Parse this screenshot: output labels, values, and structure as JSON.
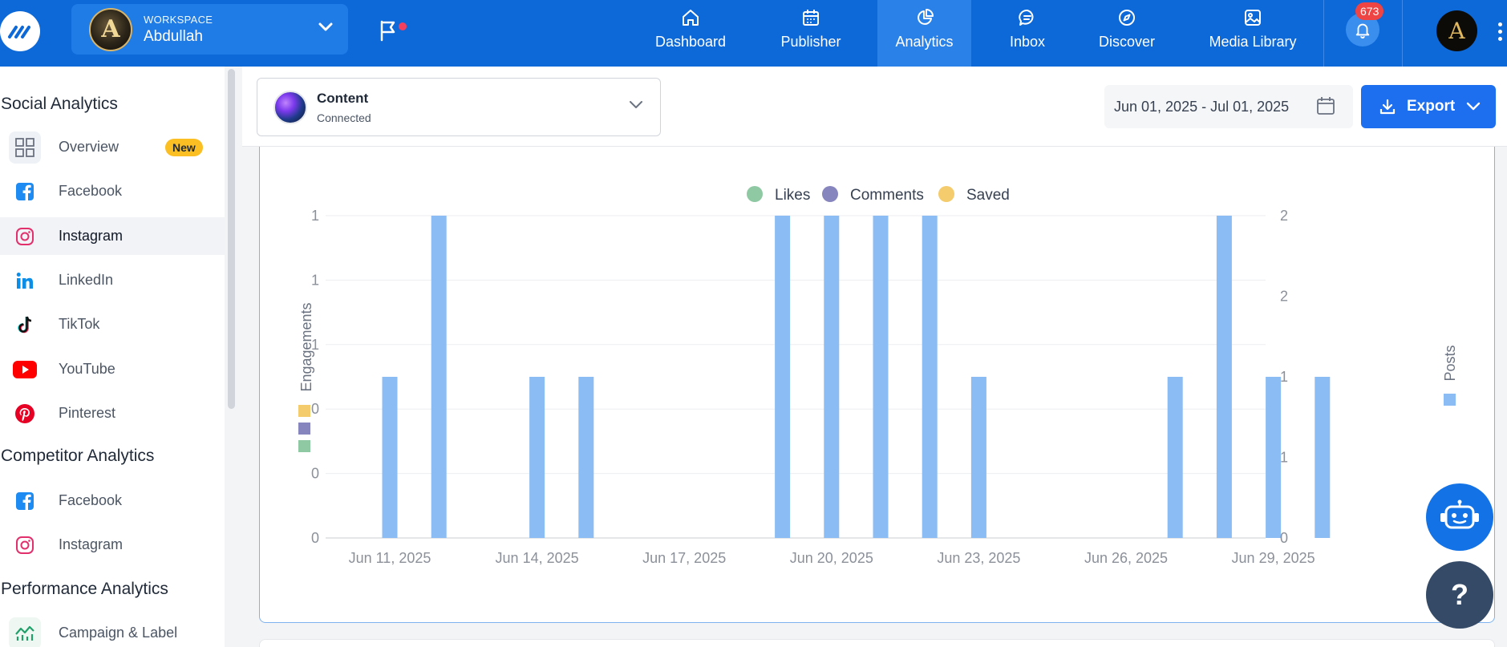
{
  "workspace": {
    "label": "WORKSPACE",
    "name": "Abdullah",
    "avatar_letter": "A"
  },
  "nav": [
    {
      "label": "Dashboard",
      "icon": "home-icon"
    },
    {
      "label": "Publisher",
      "icon": "calendar-icon"
    },
    {
      "label": "Analytics",
      "icon": "pie-chart-icon",
      "active": true
    },
    {
      "label": "Inbox",
      "icon": "chat-icon"
    },
    {
      "label": "Discover",
      "icon": "compass-icon"
    },
    {
      "label": "Media Library",
      "icon": "image-icon"
    }
  ],
  "notifications": {
    "count": "673"
  },
  "user": {
    "avatar_letter": "A"
  },
  "sidebar": {
    "social_heading": "Social Analytics",
    "social_items": [
      {
        "label": "Overview",
        "badge": "New"
      },
      {
        "label": "Facebook"
      },
      {
        "label": "Instagram",
        "active": true
      },
      {
        "label": "LinkedIn"
      },
      {
        "label": "TikTok"
      },
      {
        "label": "YouTube"
      },
      {
        "label": "Pinterest"
      }
    ],
    "competitor_heading": "Competitor Analytics",
    "competitor_items": [
      {
        "label": "Facebook"
      },
      {
        "label": "Instagram"
      }
    ],
    "performance_heading": "Performance Analytics",
    "performance_items": [
      {
        "label": "Campaign & Label"
      }
    ]
  },
  "content_select": {
    "title": "Content",
    "subtitle": "Connected"
  },
  "date_range": {
    "value": "Jun 01, 2025 - Jul 01, 2025"
  },
  "export": {
    "label": "Export"
  },
  "help": {
    "label": "?"
  },
  "colors": {
    "accent": "#0d68d8",
    "likes": "#8fc9a4",
    "comments": "#8685bd",
    "saved": "#f4cb6d",
    "posts": "#8bbcf3"
  },
  "chart_data": {
    "type": "bar",
    "legend": [
      "Likes",
      "Comments",
      "Saved"
    ],
    "ylabel_left": "Engagements",
    "ylabel_right": "Posts",
    "left_ticks": [
      "0",
      "0",
      "0",
      "1",
      "1",
      "1"
    ],
    "right_ticks": [
      "0",
      "1",
      "1",
      "2",
      "2"
    ],
    "x_ticks": [
      "Jun 11, 2025",
      "Jun 14, 2025",
      "Jun 17, 2025",
      "Jun 20, 2025",
      "Jun 23, 2025",
      "Jun 26, 2025",
      "Jun 29, 2025"
    ],
    "right_ylim": [
      0,
      2
    ],
    "categories": [
      "Jun 11",
      "Jun 12",
      "Jun 13",
      "Jun 14",
      "Jun 15",
      "Jun 16",
      "Jun 17",
      "Jun 18",
      "Jun 19",
      "Jun 20",
      "Jun 21",
      "Jun 22",
      "Jun 23",
      "Jun 24",
      "Jun 25",
      "Jun 26",
      "Jun 27",
      "Jun 28",
      "Jun 29",
      "Jun 30"
    ],
    "series": [
      {
        "name": "Likes",
        "values": [
          0,
          0,
          0,
          0,
          0,
          0,
          0,
          0,
          0,
          0,
          0,
          0,
          0,
          0,
          0,
          0,
          0,
          0,
          0,
          0
        ]
      },
      {
        "name": "Comments",
        "values": [
          0,
          0,
          0,
          0,
          0,
          0,
          0,
          0,
          0,
          0,
          0,
          0,
          0,
          0,
          0,
          0,
          0,
          0,
          0,
          0
        ]
      },
      {
        "name": "Saved",
        "values": [
          0,
          0,
          0,
          0,
          0,
          0,
          0,
          0,
          0,
          0,
          0,
          0,
          0,
          0,
          0,
          0,
          0,
          0,
          0,
          0
        ]
      },
      {
        "name": "Posts",
        "values": [
          1,
          2,
          0,
          1,
          1,
          0,
          0,
          0,
          2,
          2,
          2,
          2,
          1,
          0,
          0,
          0,
          1,
          2,
          1,
          1
        ]
      }
    ],
    "grid": true
  }
}
